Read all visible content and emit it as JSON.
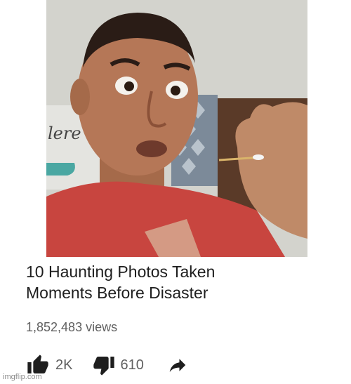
{
  "video": {
    "title_line1": "10 Haunting Photos Taken",
    "title_line2": "Moments Before Disaster",
    "views": "1,852,483 views",
    "likes": "2K",
    "dislikes": "610"
  },
  "thumbnail": {
    "wall_text": "lere"
  },
  "icons": {
    "like": "thumbs-up-icon",
    "dislike": "thumbs-down-icon",
    "share": "share-arrow-icon"
  },
  "watermark": "imgflip.com",
  "colors": {
    "text": "#1e1e1e",
    "meta": "#606060",
    "shirt": "#c8453f"
  }
}
